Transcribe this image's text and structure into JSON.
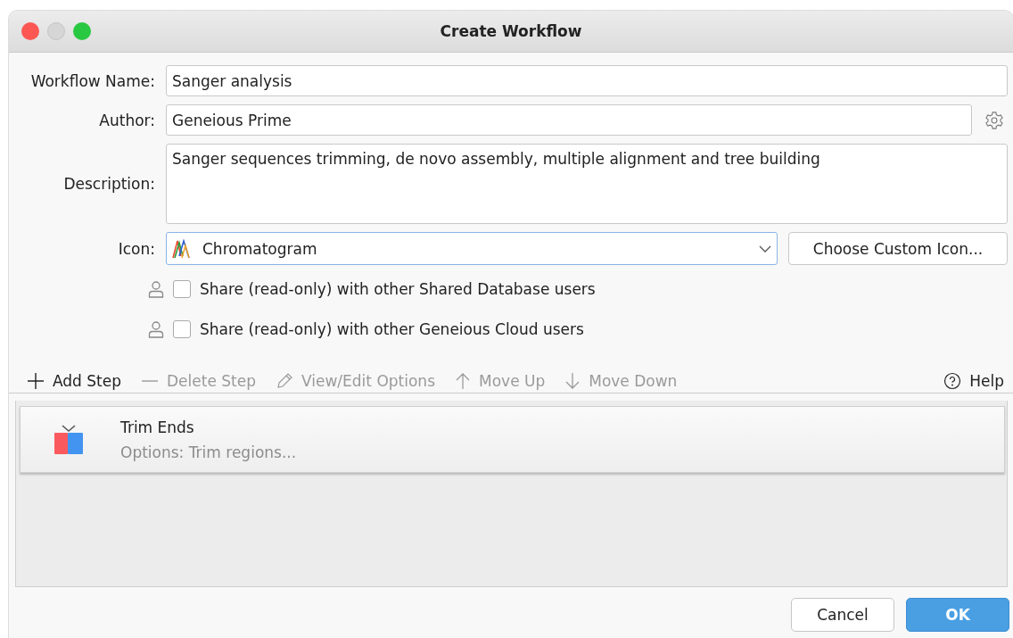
{
  "window": {
    "title": "Create Workflow"
  },
  "form": {
    "workflow_name": {
      "label": "Workflow Name:",
      "value": "Sanger analysis"
    },
    "author": {
      "label": "Author:",
      "value": "Geneious Prime"
    },
    "description": {
      "label": "Description:",
      "value": "Sanger sequences trimming, de novo assembly, multiple alignment and tree building"
    },
    "icon": {
      "label": "Icon:",
      "value": "Chromatogram",
      "button": "Choose Custom Icon..."
    }
  },
  "sharing": [
    {
      "label": "Share (read-only) with other Shared Database users",
      "checked": false
    },
    {
      "label": "Share (read-only) with other Geneious Cloud users",
      "checked": false
    }
  ],
  "toolbar": [
    {
      "kind": "add",
      "label": "Add Step",
      "disabled": false
    },
    {
      "kind": "delete",
      "label": "Delete Step",
      "disabled": true
    },
    {
      "kind": "edit",
      "label": "View/Edit Options",
      "disabled": true
    },
    {
      "kind": "up",
      "label": "Move Up",
      "disabled": true
    },
    {
      "kind": "down",
      "label": "Move Down",
      "disabled": true
    },
    {
      "kind": "help",
      "label": "Help",
      "disabled": false
    }
  ],
  "steps": [
    {
      "title": "Trim Ends",
      "options": "Options: Trim regions..."
    }
  ],
  "buttons": [
    {
      "kind": "cancel",
      "label": "Cancel"
    },
    {
      "kind": "ok",
      "label": "OK"
    }
  ]
}
